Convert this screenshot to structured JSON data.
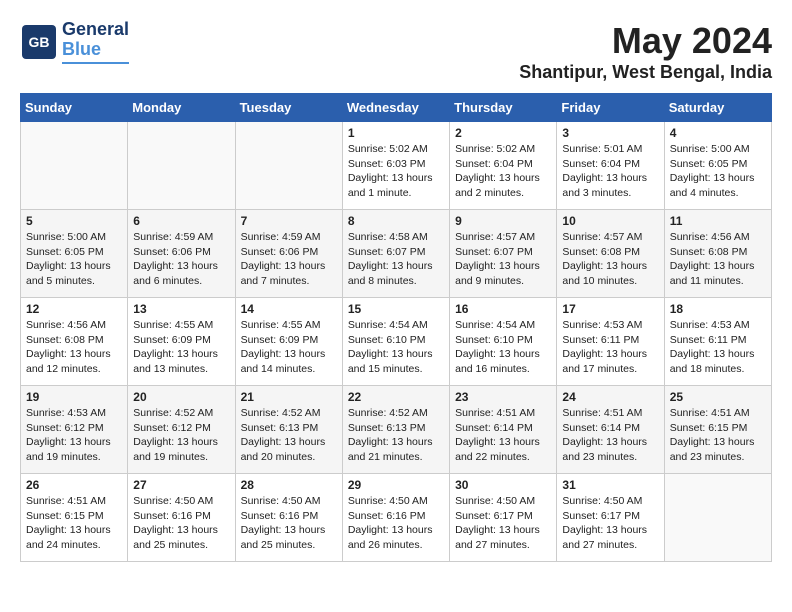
{
  "header": {
    "logo_line1": "General",
    "logo_line2": "Blue",
    "month": "May 2024",
    "location": "Shantipur, West Bengal, India"
  },
  "weekdays": [
    "Sunday",
    "Monday",
    "Tuesday",
    "Wednesday",
    "Thursday",
    "Friday",
    "Saturday"
  ],
  "weeks": [
    [
      {
        "day": "",
        "content": ""
      },
      {
        "day": "",
        "content": ""
      },
      {
        "day": "",
        "content": ""
      },
      {
        "day": "1",
        "content": "Sunrise: 5:02 AM\nSunset: 6:03 PM\nDaylight: 13 hours\nand 1 minute."
      },
      {
        "day": "2",
        "content": "Sunrise: 5:02 AM\nSunset: 6:04 PM\nDaylight: 13 hours\nand 2 minutes."
      },
      {
        "day": "3",
        "content": "Sunrise: 5:01 AM\nSunset: 6:04 PM\nDaylight: 13 hours\nand 3 minutes."
      },
      {
        "day": "4",
        "content": "Sunrise: 5:00 AM\nSunset: 6:05 PM\nDaylight: 13 hours\nand 4 minutes."
      }
    ],
    [
      {
        "day": "5",
        "content": "Sunrise: 5:00 AM\nSunset: 6:05 PM\nDaylight: 13 hours\nand 5 minutes."
      },
      {
        "day": "6",
        "content": "Sunrise: 4:59 AM\nSunset: 6:06 PM\nDaylight: 13 hours\nand 6 minutes."
      },
      {
        "day": "7",
        "content": "Sunrise: 4:59 AM\nSunset: 6:06 PM\nDaylight: 13 hours\nand 7 minutes."
      },
      {
        "day": "8",
        "content": "Sunrise: 4:58 AM\nSunset: 6:07 PM\nDaylight: 13 hours\nand 8 minutes."
      },
      {
        "day": "9",
        "content": "Sunrise: 4:57 AM\nSunset: 6:07 PM\nDaylight: 13 hours\nand 9 minutes."
      },
      {
        "day": "10",
        "content": "Sunrise: 4:57 AM\nSunset: 6:08 PM\nDaylight: 13 hours\nand 10 minutes."
      },
      {
        "day": "11",
        "content": "Sunrise: 4:56 AM\nSunset: 6:08 PM\nDaylight: 13 hours\nand 11 minutes."
      }
    ],
    [
      {
        "day": "12",
        "content": "Sunrise: 4:56 AM\nSunset: 6:08 PM\nDaylight: 13 hours\nand 12 minutes."
      },
      {
        "day": "13",
        "content": "Sunrise: 4:55 AM\nSunset: 6:09 PM\nDaylight: 13 hours\nand 13 minutes."
      },
      {
        "day": "14",
        "content": "Sunrise: 4:55 AM\nSunset: 6:09 PM\nDaylight: 13 hours\nand 14 minutes."
      },
      {
        "day": "15",
        "content": "Sunrise: 4:54 AM\nSunset: 6:10 PM\nDaylight: 13 hours\nand 15 minutes."
      },
      {
        "day": "16",
        "content": "Sunrise: 4:54 AM\nSunset: 6:10 PM\nDaylight: 13 hours\nand 16 minutes."
      },
      {
        "day": "17",
        "content": "Sunrise: 4:53 AM\nSunset: 6:11 PM\nDaylight: 13 hours\nand 17 minutes."
      },
      {
        "day": "18",
        "content": "Sunrise: 4:53 AM\nSunset: 6:11 PM\nDaylight: 13 hours\nand 18 minutes."
      }
    ],
    [
      {
        "day": "19",
        "content": "Sunrise: 4:53 AM\nSunset: 6:12 PM\nDaylight: 13 hours\nand 19 minutes."
      },
      {
        "day": "20",
        "content": "Sunrise: 4:52 AM\nSunset: 6:12 PM\nDaylight: 13 hours\nand 19 minutes."
      },
      {
        "day": "21",
        "content": "Sunrise: 4:52 AM\nSunset: 6:13 PM\nDaylight: 13 hours\nand 20 minutes."
      },
      {
        "day": "22",
        "content": "Sunrise: 4:52 AM\nSunset: 6:13 PM\nDaylight: 13 hours\nand 21 minutes."
      },
      {
        "day": "23",
        "content": "Sunrise: 4:51 AM\nSunset: 6:14 PM\nDaylight: 13 hours\nand 22 minutes."
      },
      {
        "day": "24",
        "content": "Sunrise: 4:51 AM\nSunset: 6:14 PM\nDaylight: 13 hours\nand 23 minutes."
      },
      {
        "day": "25",
        "content": "Sunrise: 4:51 AM\nSunset: 6:15 PM\nDaylight: 13 hours\nand 23 minutes."
      }
    ],
    [
      {
        "day": "26",
        "content": "Sunrise: 4:51 AM\nSunset: 6:15 PM\nDaylight: 13 hours\nand 24 minutes."
      },
      {
        "day": "27",
        "content": "Sunrise: 4:50 AM\nSunset: 6:16 PM\nDaylight: 13 hours\nand 25 minutes."
      },
      {
        "day": "28",
        "content": "Sunrise: 4:50 AM\nSunset: 6:16 PM\nDaylight: 13 hours\nand 25 minutes."
      },
      {
        "day": "29",
        "content": "Sunrise: 4:50 AM\nSunset: 6:16 PM\nDaylight: 13 hours\nand 26 minutes."
      },
      {
        "day": "30",
        "content": "Sunrise: 4:50 AM\nSunset: 6:17 PM\nDaylight: 13 hours\nand 27 minutes."
      },
      {
        "day": "31",
        "content": "Sunrise: 4:50 AM\nSunset: 6:17 PM\nDaylight: 13 hours\nand 27 minutes."
      },
      {
        "day": "",
        "content": ""
      }
    ]
  ]
}
